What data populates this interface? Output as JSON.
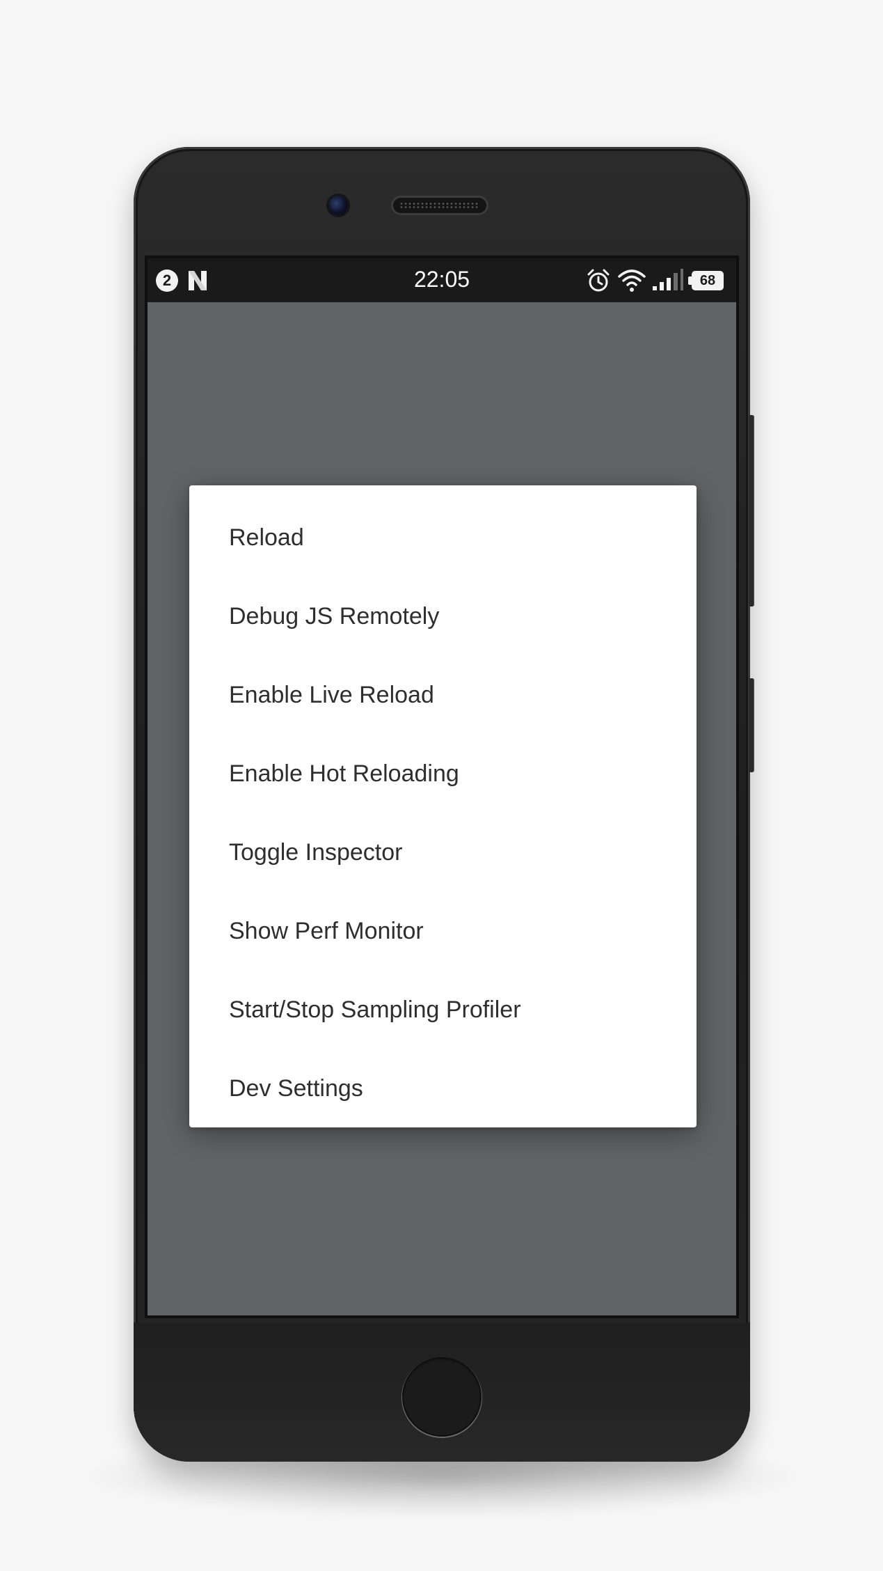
{
  "statusbar": {
    "notification_count": "2",
    "time": "22:05",
    "battery_level": "68"
  },
  "dev_menu": {
    "items": [
      {
        "label": "Reload"
      },
      {
        "label": "Debug JS Remotely"
      },
      {
        "label": "Enable Live Reload"
      },
      {
        "label": "Enable Hot Reloading"
      },
      {
        "label": "Toggle Inspector"
      },
      {
        "label": "Show Perf Monitor"
      },
      {
        "label": "Start/Stop Sampling Profiler"
      },
      {
        "label": "Dev Settings"
      }
    ]
  },
  "icons": {
    "notification": "notification-count-icon",
    "app": "n-logo-icon",
    "alarm": "alarm-clock-icon",
    "wifi": "wifi-icon",
    "signal": "cell-signal-icon",
    "battery": "battery-icon"
  },
  "colors": {
    "backdrop": "#606466",
    "dialog": "#ffffff",
    "menu_text": "#2e2e2e",
    "statusbar": "#1a1a1a",
    "phone_body": "#232323"
  }
}
